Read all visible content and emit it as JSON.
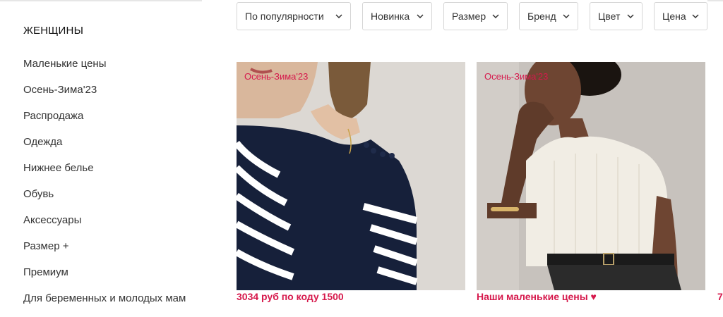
{
  "sidebar": {
    "title": "ЖЕНЩИНЫ",
    "items": [
      {
        "label": "Маленькие цены"
      },
      {
        "label": "Осень-Зима'23"
      },
      {
        "label": "Распродажа"
      },
      {
        "label": "Одежда"
      },
      {
        "label": "Нижнее белье"
      },
      {
        "label": "Обувь"
      },
      {
        "label": "Аксессуары"
      },
      {
        "label": "Размер +"
      },
      {
        "label": "Премиум"
      },
      {
        "label": "Для беременных и молодых мам"
      }
    ]
  },
  "filters": {
    "sort": "По популярности",
    "new": "Новинка",
    "size": "Размер",
    "brand": "Бренд",
    "color": "Цвет",
    "price": "Цена"
  },
  "products": [
    {
      "tag": "Осень-Зима'23",
      "price_label": "3034 руб по коду 1500",
      "image": "striped-navy-sweater-photo"
    },
    {
      "tag": "Осень-Зима'23",
      "price_label": "Наши маленькие цены ♥",
      "image": "white-knit-top-photo"
    }
  ],
  "next_product_price_fragment": "7",
  "colors": {
    "accent": "#d6194c",
    "border": "#d6d6d6",
    "text": "#333333"
  }
}
